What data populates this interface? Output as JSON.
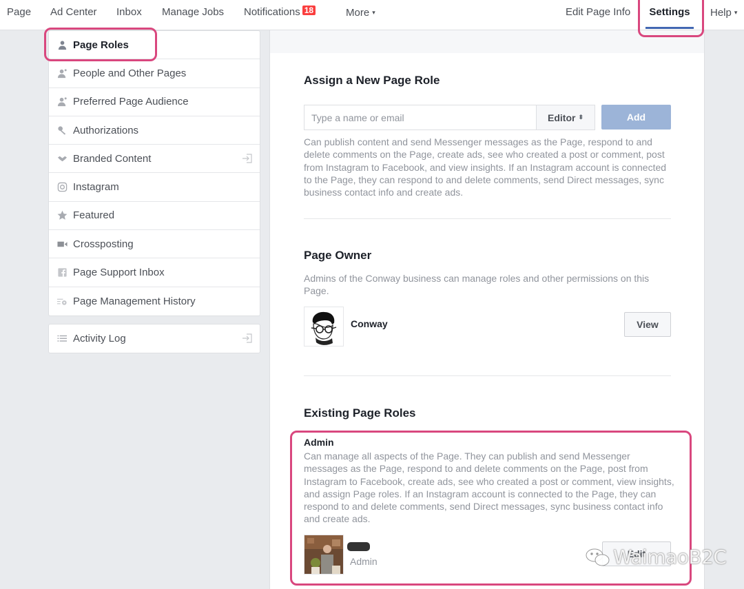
{
  "topnav": {
    "left_items": [
      {
        "label": "Page"
      },
      {
        "label": "Ad Center"
      },
      {
        "label": "Inbox"
      },
      {
        "label": "Manage Jobs"
      },
      {
        "label": "Notifications",
        "badge": "18"
      },
      {
        "label": "More",
        "has_caret": true
      }
    ],
    "right_items": [
      {
        "label": "Edit Page Info"
      },
      {
        "label": "Settings",
        "active": true
      },
      {
        "label": "Help",
        "has_caret": true
      }
    ],
    "caret_glyph": "▾"
  },
  "sidebar": {
    "items": [
      {
        "label": "Page Roles",
        "icon": "person-icon",
        "active": true
      },
      {
        "label": "People and Other Pages",
        "icon": "person-add-icon"
      },
      {
        "label": "Preferred Page Audience",
        "icon": "person-add-icon"
      },
      {
        "label": "Authorizations",
        "icon": "wrench-icon"
      },
      {
        "label": "Branded Content",
        "icon": "handshake-icon",
        "external": true
      },
      {
        "label": "Instagram",
        "icon": "instagram-icon"
      },
      {
        "label": "Featured",
        "icon": "star-icon"
      },
      {
        "label": "Crossposting",
        "icon": "video-camera-icon"
      },
      {
        "label": "Page Support Inbox",
        "icon": "facebook-icon"
      },
      {
        "label": "Page Management History",
        "icon": "history-gear-icon"
      }
    ],
    "secondary_items": [
      {
        "label": "Activity Log",
        "icon": "list-icon",
        "external": true
      }
    ]
  },
  "assign": {
    "title": "Assign a New Page Role",
    "input_placeholder": "Type a name or email",
    "input_value": "",
    "role_selected": "Editor",
    "role_sort_glyph": "⬍",
    "add_label": "Add",
    "description": "Can publish content and send Messenger messages as the Page, respond to and delete comments on the Page, create ads, see who created a post or comment, post from Instagram to Facebook, and view insights. If an Instagram account is connected to the Page, they can respond to and delete comments, send Direct messages, sync business contact info and create ads."
  },
  "owner": {
    "title": "Page Owner",
    "description": "Admins of the Conway business can manage roles and other permissions on this Page.",
    "name": "Conway",
    "view_label": "View"
  },
  "existing": {
    "title": "Existing Page Roles",
    "role_name": "Admin",
    "role_description": "Can manage all aspects of the Page. They can publish and send Messenger messages as the Page, respond to and delete comments on the Page, post from Instagram to Facebook, create ads, see who created a post or comment, view insights, and assign Page roles. If an Instagram account is connected to the Page, they can respond to and delete comments, send Direct messages, sync business contact info and create ads.",
    "member_role": "Admin",
    "edit_label": "Edit"
  },
  "watermark": {
    "text": "WaimaoB2C"
  },
  "colors": {
    "accent": "#4267b2",
    "highlight": "#d9477e",
    "badge": "#fa3e3e",
    "add_button": "#9cb4d8"
  }
}
